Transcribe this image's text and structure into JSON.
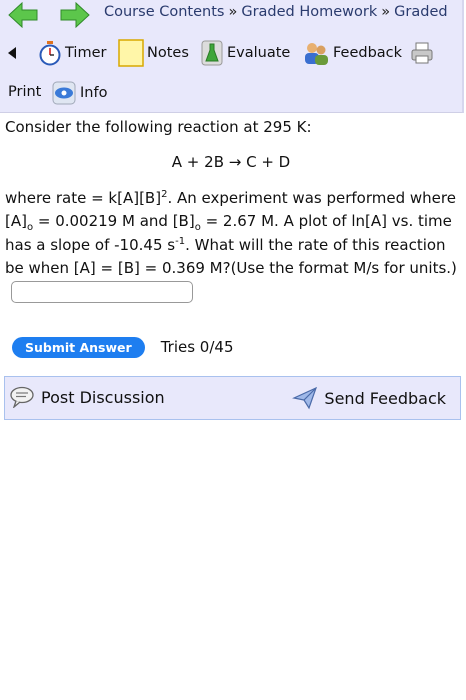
{
  "nav": {
    "crumbs": [
      "Course Contents",
      "Graded Homework",
      "Graded"
    ],
    "separator": "»"
  },
  "tools": {
    "timer": "Timer",
    "notes": "Notes",
    "evaluate": "Evaluate",
    "feedback": "Feedback",
    "print": "Print",
    "info": "Info"
  },
  "question": {
    "intro": "Consider the following reaction at 295 K:",
    "equation": "A + 2B → C + D",
    "where_rate": "where rate = k[A][B]",
    "rate_exp": "2",
    "experiment": ". An experiment was performed where [A]",
    "sub_o": "o",
    "a0_value": " = 0.00219 M and [B]",
    "b0_value": " = 2.67 M. A plot of ln[A] vs. time has a slope of -10.45 s",
    "slope_exp": "-1",
    "ending": ". What will the rate of this reaction be when [A] = [B] = 0.369 M?(Use the format M/s for units.)",
    "answer_value": ""
  },
  "submit": {
    "label": "Submit Answer",
    "tries": "Tries 0/45"
  },
  "discussion": {
    "post": "Post Discussion",
    "send": "Send Feedback"
  },
  "colors": {
    "toolbar_bg": "#e8e8fb",
    "submit_bg": "#1e7ef0",
    "nav_arrow": "#5cc64b"
  }
}
